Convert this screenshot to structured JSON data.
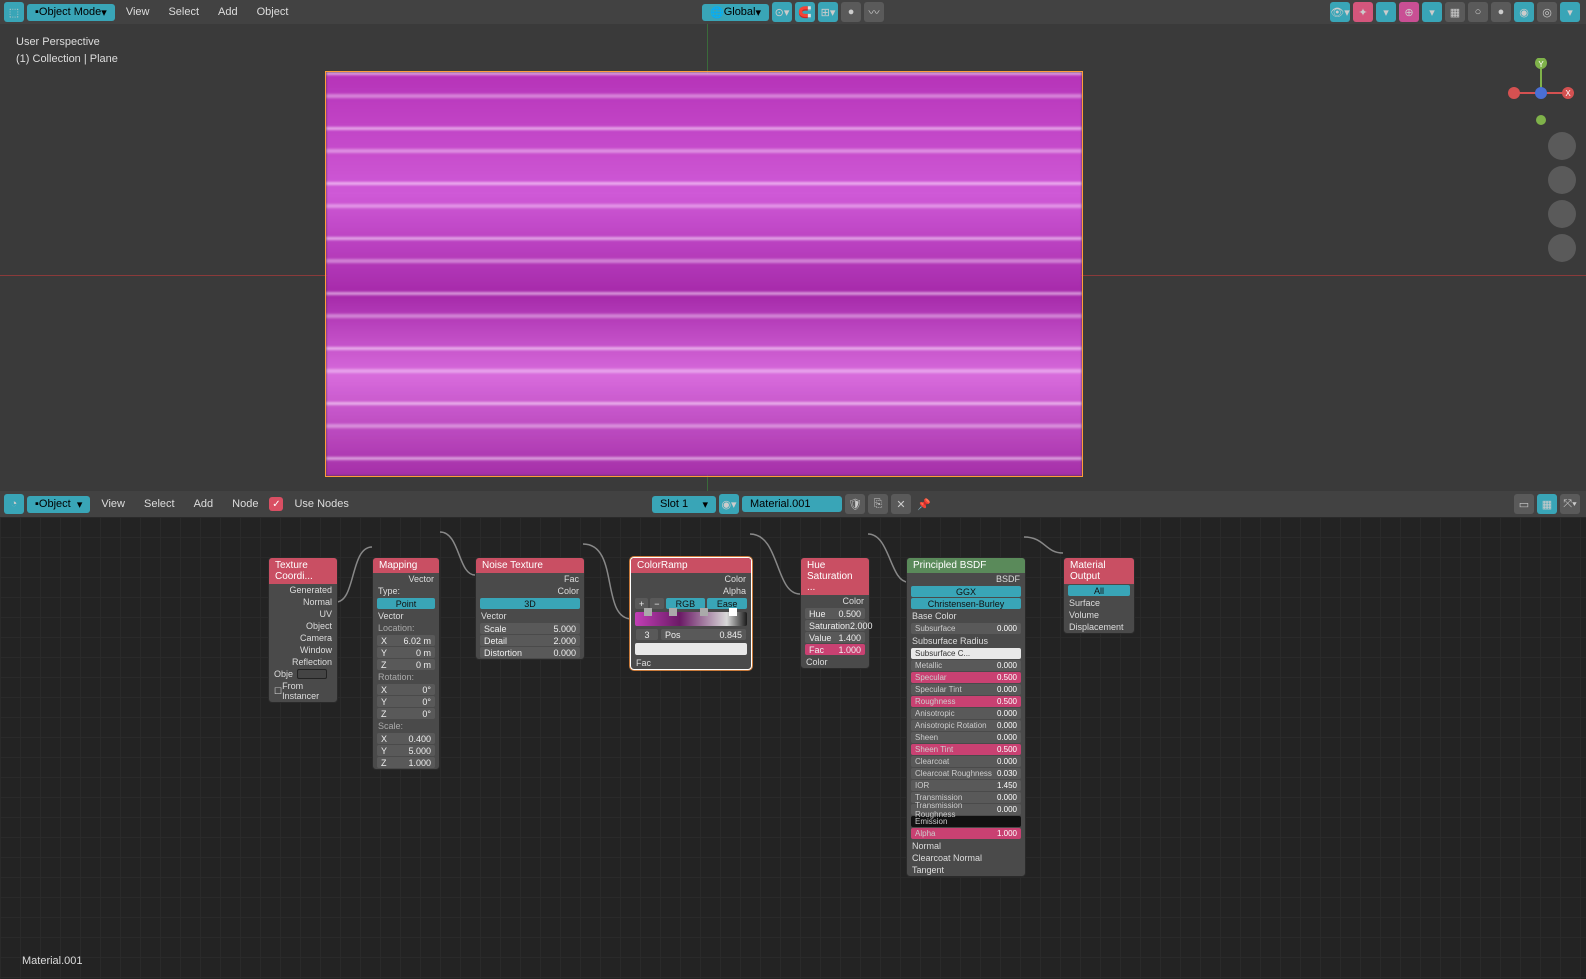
{
  "viewport_header": {
    "mode": "Object Mode",
    "menus": [
      "View",
      "Select",
      "Add",
      "Object"
    ],
    "orientation": "Global"
  },
  "viewport_info": {
    "line1": "User Perspective",
    "line2": "(1) Collection | Plane"
  },
  "node_header": {
    "mode": "Object",
    "menus": [
      "View",
      "Select",
      "Add",
      "Node"
    ],
    "use_nodes": "Use Nodes",
    "slot": "Slot 1",
    "material": "Material.001"
  },
  "material_label": "Material.001",
  "nodes": {
    "texcoord": {
      "title": "Texture Coordi...",
      "outs": [
        "Generated",
        "Normal",
        "UV",
        "Object",
        "Camera",
        "Window",
        "Reflection"
      ],
      "obj_label": "Obje",
      "from_instancer": "From Instancer"
    },
    "mapping": {
      "title": "Mapping",
      "vector_out": "Vector",
      "type_label": "Type:",
      "type_value": "Point",
      "vector_in": "Vector",
      "location": "Location:",
      "loc_x": "6.02 m",
      "loc_y": "0 m",
      "loc_z": "0 m",
      "rotation": "Rotation:",
      "rot_x": "0°",
      "rot_y": "0°",
      "rot_z": "0°",
      "scale": "Scale:",
      "scl_x": "0.400",
      "scl_y": "5.000",
      "scl_z": "1.000"
    },
    "noise": {
      "title": "Noise Texture",
      "out_fac": "Fac",
      "out_color": "Color",
      "dim": "3D",
      "vector": "Vector",
      "scale_l": "Scale",
      "scale_v": "5.000",
      "detail_l": "Detail",
      "detail_v": "2.000",
      "distortion_l": "Distortion",
      "distortion_v": "0.000"
    },
    "colorramp": {
      "title": "ColorRamp",
      "out_color": "Color",
      "out_alpha": "Alpha",
      "mode": "RGB",
      "interp": "Ease",
      "idx": "3",
      "pos_l": "Pos",
      "pos_v": "0.845",
      "fac": "Fac"
    },
    "huesat": {
      "title": "Hue Saturation ...",
      "out_color": "Color",
      "hue_l": "Hue",
      "hue_v": "0.500",
      "sat_l": "Saturation",
      "sat_v": "2.000",
      "val_l": "Value",
      "val_v": "1.400",
      "fac_l": "Fac",
      "fac_v": "1.000",
      "color_in": "Color"
    },
    "bsdf": {
      "title": "Principled BSDF",
      "out": "BSDF",
      "dist": "GGX",
      "sss": "Christensen-Burley",
      "rows": [
        {
          "l": "Base Color",
          "v": ""
        },
        {
          "l": "Subsurface",
          "v": "0.000"
        },
        {
          "l": "Subsurface Radius",
          "v": ""
        },
        {
          "l": "Subsurface C...",
          "v": ""
        },
        {
          "l": "Metallic",
          "v": "0.000"
        },
        {
          "l": "Specular",
          "v": "0.500",
          "pink": true
        },
        {
          "l": "Specular Tint",
          "v": "0.000"
        },
        {
          "l": "Roughness",
          "v": "0.500",
          "pink": true
        },
        {
          "l": "Anisotropic",
          "v": "0.000"
        },
        {
          "l": "Anisotropic Rotation",
          "v": "0.000"
        },
        {
          "l": "Sheen",
          "v": "0.000"
        },
        {
          "l": "Sheen Tint",
          "v": "0.500",
          "pink": true
        },
        {
          "l": "Clearcoat",
          "v": "0.000"
        },
        {
          "l": "Clearcoat Roughness",
          "v": "0.030"
        },
        {
          "l": "IOR",
          "v": "1.450"
        },
        {
          "l": "Transmission",
          "v": "0.000"
        },
        {
          "l": "Transmission Roughness",
          "v": "0.000"
        },
        {
          "l": "Emission",
          "v": ""
        },
        {
          "l": "Alpha",
          "v": "1.000",
          "pink": true
        },
        {
          "l": "Normal",
          "v": ""
        },
        {
          "l": "Clearcoat Normal",
          "v": ""
        },
        {
          "l": "Tangent",
          "v": ""
        }
      ]
    },
    "output": {
      "title": "Material Output",
      "target": "All",
      "ins": [
        "Surface",
        "Volume",
        "Displacement"
      ]
    }
  }
}
